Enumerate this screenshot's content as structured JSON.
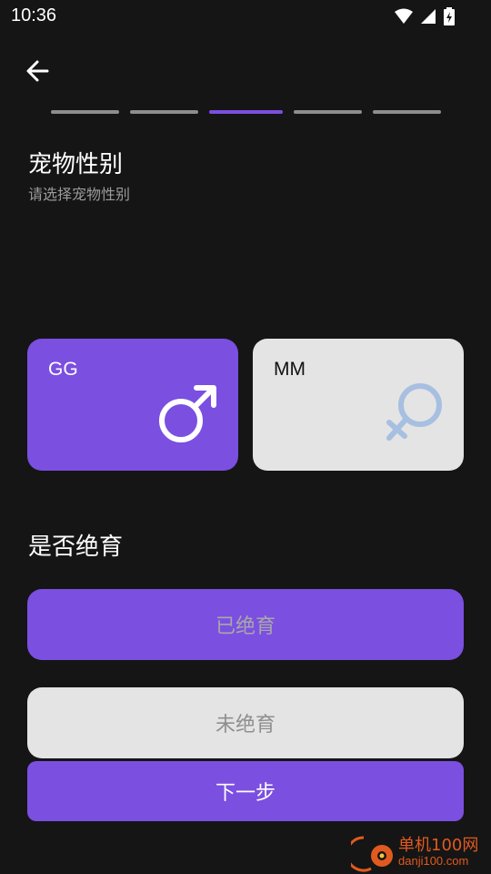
{
  "status_bar": {
    "time": "10:36",
    "icons": [
      "wifi-icon",
      "signal-icon",
      "battery-charging-icon"
    ]
  },
  "nav": {
    "back_icon": "arrow-left-icon"
  },
  "progress": {
    "total_steps": 5,
    "current_step": 3
  },
  "header": {
    "title": "宠物性别",
    "subtitle": "请选择宠物性别"
  },
  "gender": {
    "male": {
      "label": "GG",
      "icon": "male-symbol-icon",
      "selected": true
    },
    "female": {
      "label": "MM",
      "icon": "female-symbol-icon",
      "selected": false
    }
  },
  "neuter": {
    "title": "是否绝育",
    "neutered_label": "已绝育",
    "not_neutered_label": "未绝育"
  },
  "next_label": "下一步",
  "watermark": {
    "line1": "单机100网",
    "line2": "danji100.com"
  },
  "colors": {
    "accent": "#7b4fe0",
    "background": "#151515",
    "card_light": "#e4e4e4",
    "female_icon": "#a7bfe0"
  }
}
